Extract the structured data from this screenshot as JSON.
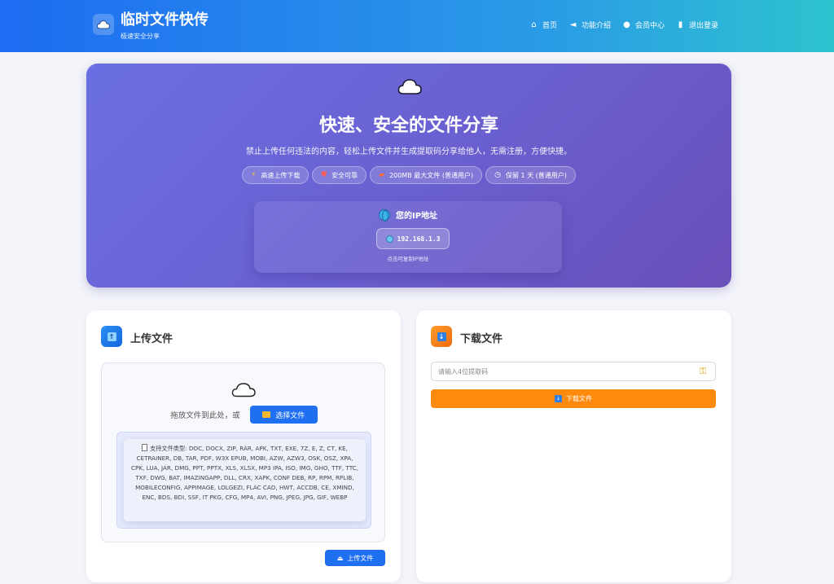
{
  "header": {
    "title": "临时文件快传",
    "subtitle": "极速安全分享",
    "nav": [
      {
        "label": "首页",
        "icon": "home-icon"
      },
      {
        "label": "功能介绍",
        "icon": "megaphone-icon"
      },
      {
        "label": "会员中心",
        "icon": "user-icon"
      },
      {
        "label": "退出登录",
        "icon": "door-icon"
      }
    ]
  },
  "hero": {
    "title": "快速、安全的文件分享",
    "description": "禁止上传任何违法的内容，轻松上传文件并生成提取码分享给他人，无需注册，方便快捷。",
    "chips": [
      {
        "label": "高速上传下载",
        "icon": "lightning-icon"
      },
      {
        "label": "安全可靠",
        "icon": "shield-icon"
      },
      {
        "label": "200MB 最大文件 (普通用户)",
        "icon": "truck-icon"
      },
      {
        "label": "保留 1 天 (普通用户)",
        "icon": "clock-icon"
      }
    ],
    "ip": {
      "heading": "您的IP地址",
      "value": "192.168.1.3",
      "hint": "点击可复制IP地址"
    }
  },
  "upload": {
    "title": "上传文件",
    "drop_text": "拖放文件到此处，或",
    "select_button": "选择文件",
    "types_text": "支持文件类型: DOC, DOCX, ZIP, RAR, APK, TXT, EXE, 7Z, E, Z, CT, KE, CETRAINER, DB, TAR, PDF, W3X EPUB, MOBI, AZW, AZW3, OSK, OSZ, XPA, CPK, LUA, JAR, DMG, PPT, PPTX, XLS, XLSX, MP3 IPA, ISO, IMG, GHO, TTF, TTC, TXF, DWG, BAT, IMAZINGAPP, DLL, CRX, XAPK, CONF DEB, RP, RPM, RPLIB, MOBILECONFIG, APPIMAGE, LOLGEZI, FLAC CAD, HWT, ACCDB, CE, XMIND, ENC, BDS, BDI, SSF, IT PKG, CFG, MP4, AVI, PNG, JPEG, JPG, GIF, WEBP",
    "upload_button": "上传文件"
  },
  "download": {
    "title": "下载文件",
    "input_placeholder": "请输入4位提取码",
    "input_value": "",
    "download_button": "下载文件"
  }
}
